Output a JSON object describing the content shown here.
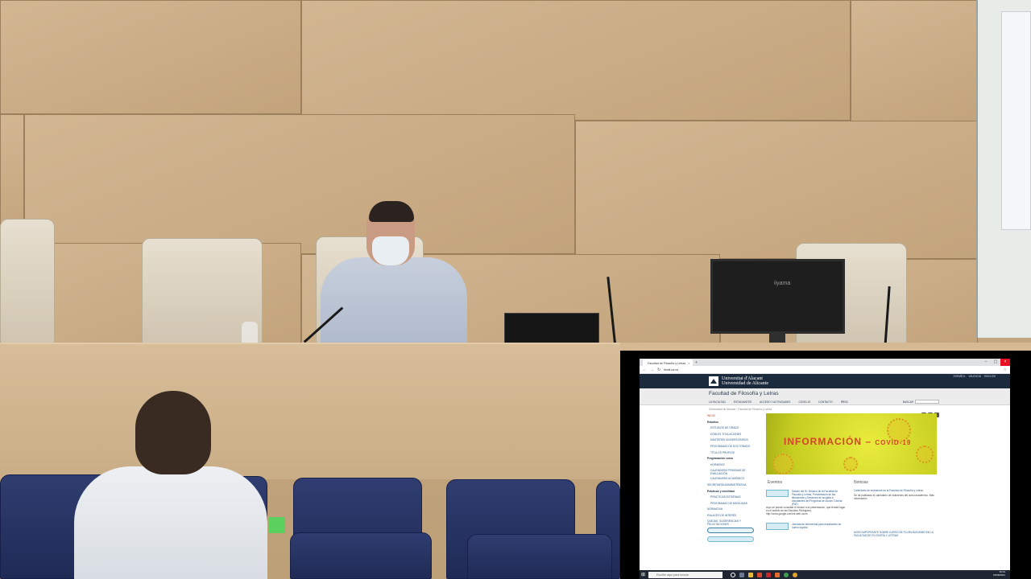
{
  "scene": {
    "monitor_brand": "iiyama"
  },
  "browser": {
    "tab_title": "Facultad de Filosofía y Letras",
    "url": "fieslit.ua.es",
    "university": {
      "name_va": "Universitat d'Alacant",
      "name_es": "Universidad de Alicante"
    },
    "languages": [
      "ESPAÑOL",
      "VALENCIÀ",
      "ENGLISH"
    ],
    "faculty_title": "Facultad de Filosofía y Letras",
    "menu": [
      "LA FACULTAD",
      "ESTUDIANTES",
      "ACCESO Y ACTIVIDADES",
      "COVID-19",
      "CONTACTO",
      "RRSS"
    ],
    "search_label": "BUSCAR",
    "breadcrumb": "Universidad de Alicante › Facultad de Filosofía y Letras",
    "sidebar": [
      {
        "label": "INICIO",
        "kind": "inicio"
      },
      {
        "label": "Estudios",
        "kind": "head"
      },
      {
        "label": "ESTUDIOS DE GRADO",
        "kind": "sub"
      },
      {
        "label": "DOBLES TITULACIONES",
        "kind": "sub"
      },
      {
        "label": "MÁSTERES UNIVERSITARIOS",
        "kind": "sub"
      },
      {
        "label": "PROGRAMAS DE DOCTORADO",
        "kind": "sub"
      },
      {
        "label": "TÍTULOS PROPIOS",
        "kind": "sub"
      },
      {
        "label": "Programación curso",
        "kind": "head"
      },
      {
        "label": "HORARIOS",
        "kind": "sub"
      },
      {
        "label": "CALENDARIO PRUEBAS DE EVALUACIÓN",
        "kind": "sub"
      },
      {
        "label": "CALENDARIO ACADÉMICO",
        "kind": "sub"
      },
      {
        "label": "SECRETARÍA ADMINISTRATIVA",
        "kind": "plain"
      },
      {
        "label": "Prácticas y movilidad",
        "kind": "head"
      },
      {
        "label": "PRÁCTICAS EXTERNAS",
        "kind": "sub"
      },
      {
        "label": "PROGRAMAS DE MOVILIDAD",
        "kind": "sub"
      },
      {
        "label": "NORMATIVA",
        "kind": "plain"
      },
      {
        "label": "ENLACES DE INTERÉS",
        "kind": "plain"
      },
      {
        "label": "QUEJAS, SUGERENCIAS Y FELICITACIONES",
        "kind": "plain"
      }
    ],
    "banner": {
      "text": "INFORMACIÓN",
      "covid": "COVID-19"
    },
    "events_title": "Eventos",
    "news_title": "Noticias",
    "events": [
      {
        "text": "Saludo del Sr. Decano de la Facultad de Filosofía y Letras, Presentación de las titulaciones y Sesiones de acogida a estudiantes del Programa de Acción Tutorial (PAT)"
      },
      {
        "text": "Jornada de bienvenida para estudiantes de nuevo ingreso"
      }
    ],
    "event_extra": "Aquí se puede consultar el enlace a la presentación, que tendrá lugar en el ámbito de las Estudios Filológicos: http://www.google.com/es.web.ua.es",
    "news": [
      {
        "link": "Calendario de exámenes en la Facultad de Filosofía y Letras",
        "text": "Se ha publicado el calendario de exámenes del curso académico. Más información"
      },
      {
        "link": "AVISO IMPORTANTE SOBRE CURSO DE PLURILINGÜISMO EN LA FACULTAD DE FILOSOFÍA Y LETRAS",
        "text": ""
      }
    ],
    "taskbar": {
      "search_placeholder": "Escribe aquí para buscar",
      "time": "10:13",
      "date": "15/09/2021"
    }
  }
}
